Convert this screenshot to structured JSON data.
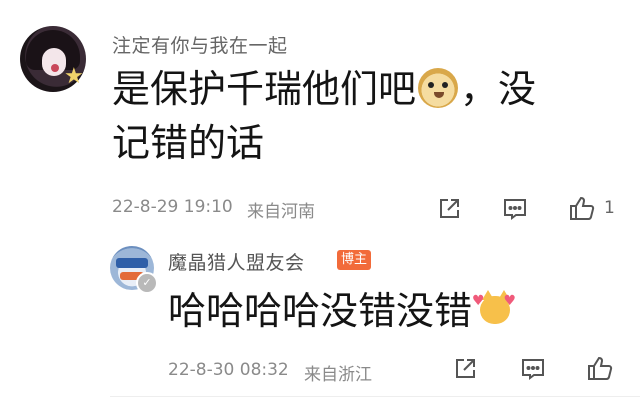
{
  "comment": {
    "username": "注定有你与我在一起",
    "text_part1": "是保护千瑞他们吧",
    "text_part2": "，没",
    "text_line2": "记错的话",
    "date": "22-8-29 19:10",
    "location": "来自河南",
    "like_count": "1",
    "icons": [
      "share-icon",
      "comment-icon",
      "like-icon"
    ]
  },
  "reply": {
    "username": "魔晶猎人盟友会",
    "badge": "博主",
    "text": "哈哈哈哈没错没错",
    "date": "22-8-30 08:32",
    "location": "来自浙江",
    "icons": [
      "share-icon",
      "comment-icon",
      "like-icon"
    ]
  },
  "colors": {
    "meta_text": "#8a8a8a",
    "owner_badge": "#f26b3a",
    "icon_stroke": "#555555"
  }
}
